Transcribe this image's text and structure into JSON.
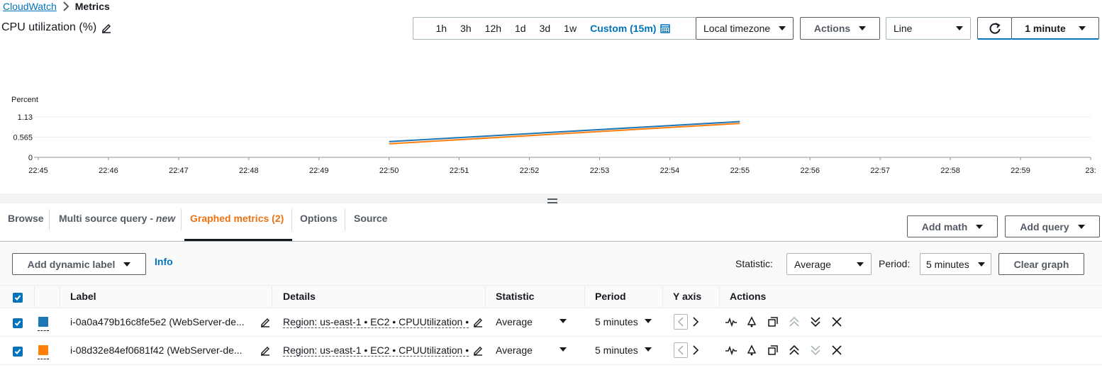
{
  "breadcrumb": {
    "root": "CloudWatch",
    "current": "Metrics"
  },
  "graph_title": "CPU utilization (%)",
  "time_range": {
    "options": [
      "1h",
      "3h",
      "12h",
      "1d",
      "3d",
      "1w"
    ],
    "custom": "Custom (15m)"
  },
  "timezone": "Local timezone",
  "actions_label": "Actions",
  "chart_type": "Line",
  "refresh_interval": "1 minute",
  "chart_data": {
    "type": "line",
    "ylabel": "Percent",
    "y_ticks": [
      "1.13",
      "0.565",
      "0"
    ],
    "ylim": [
      0,
      1.13
    ],
    "x_ticks": [
      "22:45",
      "22:46",
      "22:47",
      "22:48",
      "22:49",
      "22:50",
      "22:51",
      "22:52",
      "22:53",
      "22:54",
      "22:55",
      "22:56",
      "22:57",
      "22:58",
      "22:59",
      "23:"
    ],
    "series": [
      {
        "color": "#1f77b4",
        "x": [
          "22:50",
          "22:55"
        ],
        "y": [
          0.44,
          1.0
        ]
      },
      {
        "color": "#ff7f0e",
        "x": [
          "22:50",
          "22:55"
        ],
        "y": [
          0.38,
          0.95
        ]
      }
    ]
  },
  "tabs": {
    "browse": "Browse",
    "multi_source": "Multi source query -",
    "multi_source_new": "new",
    "graphed": "Graphed metrics (2)",
    "options": "Options",
    "source": "Source"
  },
  "add_math": "Add math",
  "add_query": "Add query",
  "add_dynamic_label": "Add dynamic label",
  "info": "Info",
  "statistic_label": "Statistic:",
  "statistic_value": "Average",
  "period_label": "Period:",
  "period_value": "5 minutes",
  "clear_graph": "Clear graph",
  "columns": {
    "label": "Label",
    "details": "Details",
    "statistic": "Statistic",
    "period": "Period",
    "yaxis": "Y axis",
    "actions": "Actions"
  },
  "rows": [
    {
      "color": "#1f77b4",
      "label": "i-0a0a479b16c8fe5e2 (WebServer-de...",
      "details": "Region: us-east-1 • EC2 • CPUUtilization •",
      "statistic": "Average",
      "period": "5 minutes"
    },
    {
      "color": "#ff7f0e",
      "label": "i-08d32e84ef0681f42 (WebServer-de...",
      "details": "Region: us-east-1 • EC2 • CPUUtilization •",
      "statistic": "Average",
      "period": "5 minutes"
    }
  ]
}
